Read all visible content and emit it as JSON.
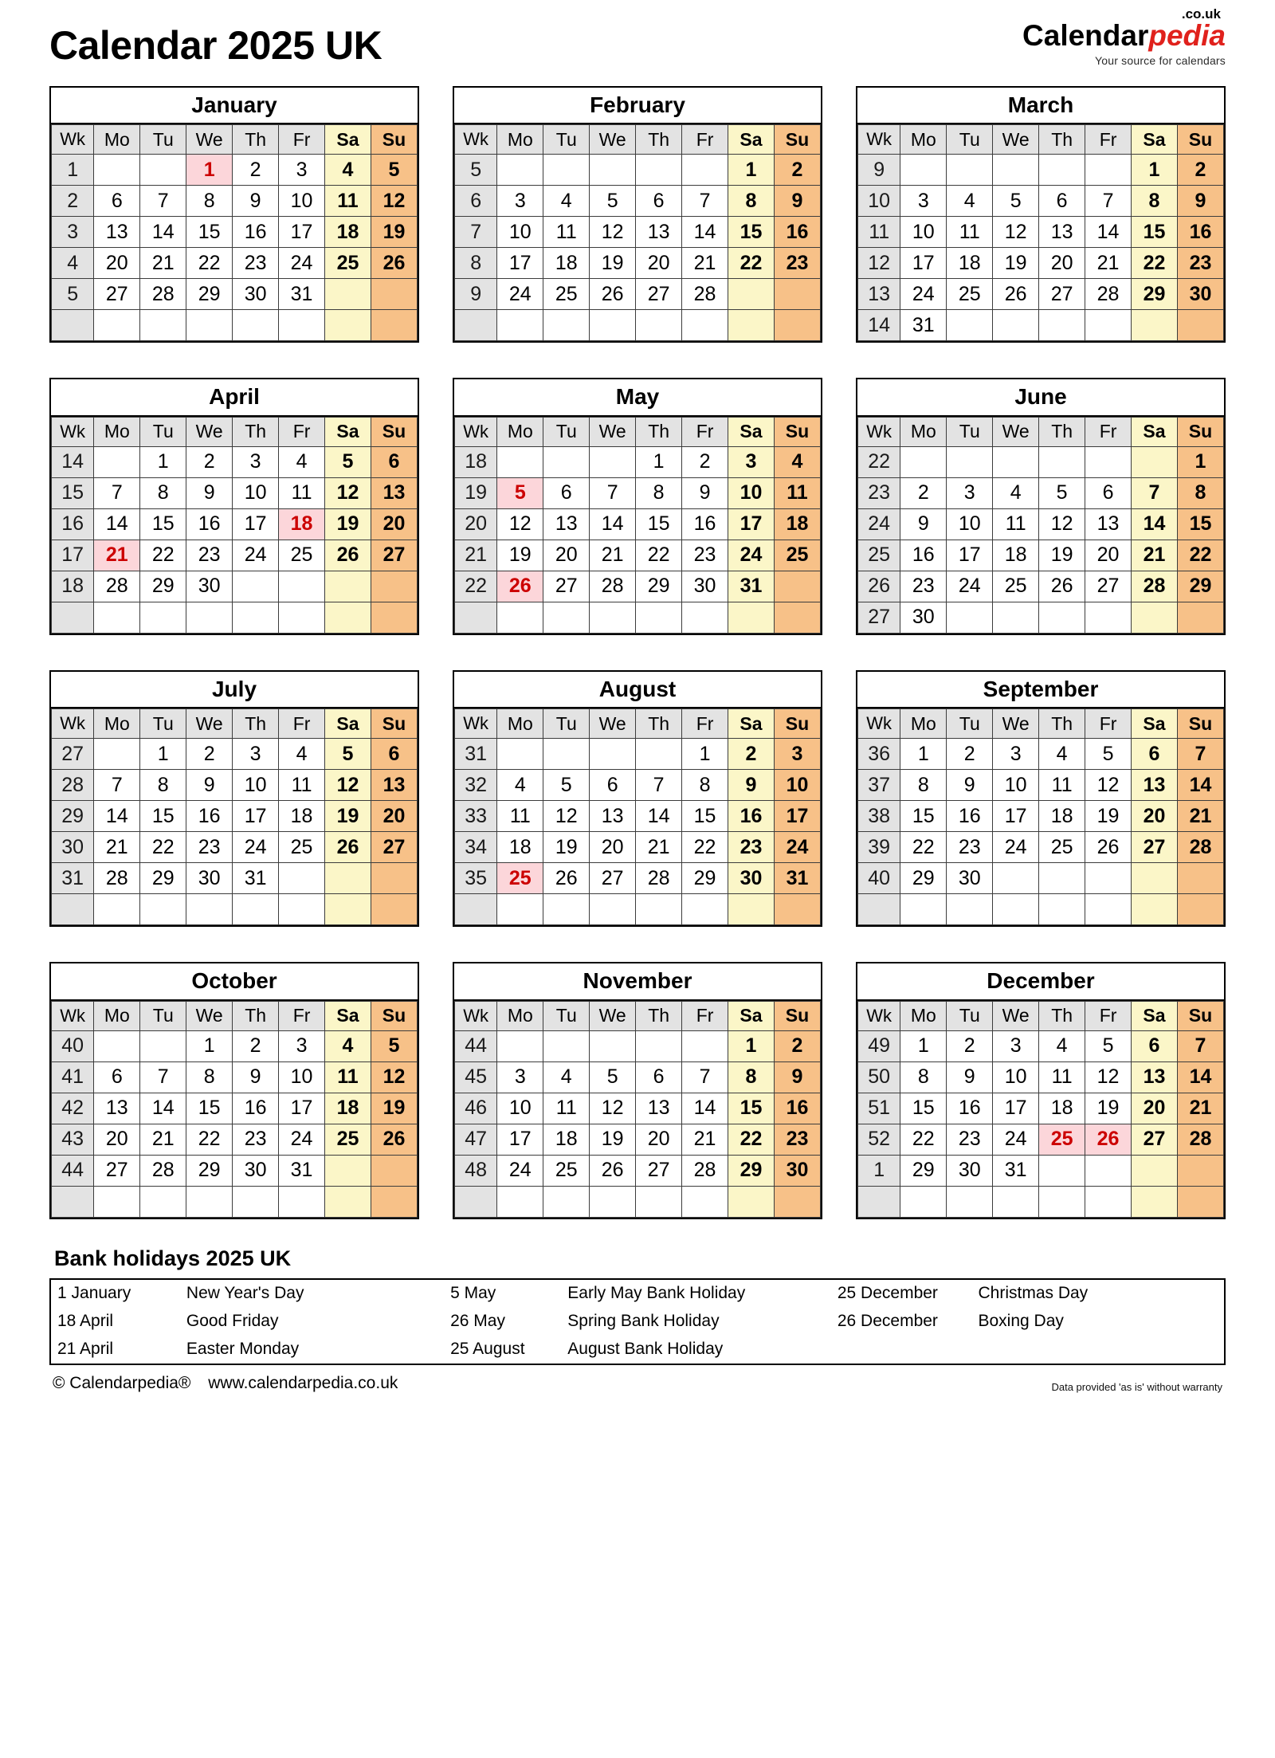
{
  "header": {
    "title": "Calendar 2025 UK",
    "brand": {
      "part_dark": "Calendar",
      "part_red": "pedia",
      "tld": ".co.uk",
      "tagline": "Your source for calendars"
    }
  },
  "weekday_headers": [
    "Wk",
    "Mo",
    "Tu",
    "We",
    "Th",
    "Fr",
    "Sa",
    "Su"
  ],
  "colors": {
    "saturday_bg": "#fbf6c8",
    "sunday_bg": "#f7c188",
    "week_bg": "#e3e3e3",
    "weekday_header_bg": "#e3e3e3",
    "holiday_bg": "#fcd6da",
    "holiday_text": "#cc0000",
    "brand_red": "#e0211c"
  },
  "months": [
    {
      "name": "January",
      "weeks": [
        {
          "wk": "1",
          "days": [
            "",
            "",
            "1",
            "2",
            "3",
            "4",
            "5"
          ],
          "holidays": [
            2
          ]
        },
        {
          "wk": "2",
          "days": [
            "6",
            "7",
            "8",
            "9",
            "10",
            "11",
            "12"
          ],
          "holidays": []
        },
        {
          "wk": "3",
          "days": [
            "13",
            "14",
            "15",
            "16",
            "17",
            "18",
            "19"
          ],
          "holidays": []
        },
        {
          "wk": "4",
          "days": [
            "20",
            "21",
            "22",
            "23",
            "24",
            "25",
            "26"
          ],
          "holidays": []
        },
        {
          "wk": "5",
          "days": [
            "27",
            "28",
            "29",
            "30",
            "31",
            "",
            ""
          ],
          "holidays": []
        },
        {
          "wk": "",
          "days": [
            "",
            "",
            "",
            "",
            "",
            "",
            ""
          ],
          "holidays": []
        }
      ]
    },
    {
      "name": "February",
      "weeks": [
        {
          "wk": "5",
          "days": [
            "",
            "",
            "",
            "",
            "",
            "1",
            "2"
          ],
          "holidays": []
        },
        {
          "wk": "6",
          "days": [
            "3",
            "4",
            "5",
            "6",
            "7",
            "8",
            "9"
          ],
          "holidays": []
        },
        {
          "wk": "7",
          "days": [
            "10",
            "11",
            "12",
            "13",
            "14",
            "15",
            "16"
          ],
          "holidays": []
        },
        {
          "wk": "8",
          "days": [
            "17",
            "18",
            "19",
            "20",
            "21",
            "22",
            "23"
          ],
          "holidays": []
        },
        {
          "wk": "9",
          "days": [
            "24",
            "25",
            "26",
            "27",
            "28",
            "",
            ""
          ],
          "holidays": []
        },
        {
          "wk": "",
          "days": [
            "",
            "",
            "",
            "",
            "",
            "",
            ""
          ],
          "holidays": []
        }
      ]
    },
    {
      "name": "March",
      "weeks": [
        {
          "wk": "9",
          "days": [
            "",
            "",
            "",
            "",
            "",
            "1",
            "2"
          ],
          "holidays": []
        },
        {
          "wk": "10",
          "days": [
            "3",
            "4",
            "5",
            "6",
            "7",
            "8",
            "9"
          ],
          "holidays": []
        },
        {
          "wk": "11",
          "days": [
            "10",
            "11",
            "12",
            "13",
            "14",
            "15",
            "16"
          ],
          "holidays": []
        },
        {
          "wk": "12",
          "days": [
            "17",
            "18",
            "19",
            "20",
            "21",
            "22",
            "23"
          ],
          "holidays": []
        },
        {
          "wk": "13",
          "days": [
            "24",
            "25",
            "26",
            "27",
            "28",
            "29",
            "30"
          ],
          "holidays": []
        },
        {
          "wk": "14",
          "days": [
            "31",
            "",
            "",
            "",
            "",
            "",
            ""
          ],
          "holidays": []
        }
      ]
    },
    {
      "name": "April",
      "weeks": [
        {
          "wk": "14",
          "days": [
            "",
            "1",
            "2",
            "3",
            "4",
            "5",
            "6"
          ],
          "holidays": []
        },
        {
          "wk": "15",
          "days": [
            "7",
            "8",
            "9",
            "10",
            "11",
            "12",
            "13"
          ],
          "holidays": []
        },
        {
          "wk": "16",
          "days": [
            "14",
            "15",
            "16",
            "17",
            "18",
            "19",
            "20"
          ],
          "holidays": [
            4
          ]
        },
        {
          "wk": "17",
          "days": [
            "21",
            "22",
            "23",
            "24",
            "25",
            "26",
            "27"
          ],
          "holidays": [
            0
          ]
        },
        {
          "wk": "18",
          "days": [
            "28",
            "29",
            "30",
            "",
            "",
            "",
            ""
          ],
          "holidays": []
        },
        {
          "wk": "",
          "days": [
            "",
            "",
            "",
            "",
            "",
            "",
            ""
          ],
          "holidays": []
        }
      ]
    },
    {
      "name": "May",
      "weeks": [
        {
          "wk": "18",
          "days": [
            "",
            "",
            "",
            "1",
            "2",
            "3",
            "4"
          ],
          "holidays": []
        },
        {
          "wk": "19",
          "days": [
            "5",
            "6",
            "7",
            "8",
            "9",
            "10",
            "11"
          ],
          "holidays": [
            0
          ]
        },
        {
          "wk": "20",
          "days": [
            "12",
            "13",
            "14",
            "15",
            "16",
            "17",
            "18"
          ],
          "holidays": []
        },
        {
          "wk": "21",
          "days": [
            "19",
            "20",
            "21",
            "22",
            "23",
            "24",
            "25"
          ],
          "holidays": []
        },
        {
          "wk": "22",
          "days": [
            "26",
            "27",
            "28",
            "29",
            "30",
            "31",
            ""
          ],
          "holidays": [
            0
          ]
        },
        {
          "wk": "",
          "days": [
            "",
            "",
            "",
            "",
            "",
            "",
            ""
          ],
          "holidays": []
        }
      ]
    },
    {
      "name": "June",
      "weeks": [
        {
          "wk": "22",
          "days": [
            "",
            "",
            "",
            "",
            "",
            "",
            "1"
          ],
          "holidays": []
        },
        {
          "wk": "23",
          "days": [
            "2",
            "3",
            "4",
            "5",
            "6",
            "7",
            "8"
          ],
          "holidays": []
        },
        {
          "wk": "24",
          "days": [
            "9",
            "10",
            "11",
            "12",
            "13",
            "14",
            "15"
          ],
          "holidays": []
        },
        {
          "wk": "25",
          "days": [
            "16",
            "17",
            "18",
            "19",
            "20",
            "21",
            "22"
          ],
          "holidays": []
        },
        {
          "wk": "26",
          "days": [
            "23",
            "24",
            "25",
            "26",
            "27",
            "28",
            "29"
          ],
          "holidays": []
        },
        {
          "wk": "27",
          "days": [
            "30",
            "",
            "",
            "",
            "",
            "",
            ""
          ],
          "holidays": []
        }
      ]
    },
    {
      "name": "July",
      "weeks": [
        {
          "wk": "27",
          "days": [
            "",
            "1",
            "2",
            "3",
            "4",
            "5",
            "6"
          ],
          "holidays": []
        },
        {
          "wk": "28",
          "days": [
            "7",
            "8",
            "9",
            "10",
            "11",
            "12",
            "13"
          ],
          "holidays": []
        },
        {
          "wk": "29",
          "days": [
            "14",
            "15",
            "16",
            "17",
            "18",
            "19",
            "20"
          ],
          "holidays": []
        },
        {
          "wk": "30",
          "days": [
            "21",
            "22",
            "23",
            "24",
            "25",
            "26",
            "27"
          ],
          "holidays": []
        },
        {
          "wk": "31",
          "days": [
            "28",
            "29",
            "30",
            "31",
            "",
            "",
            ""
          ],
          "holidays": []
        },
        {
          "wk": "",
          "days": [
            "",
            "",
            "",
            "",
            "",
            "",
            ""
          ],
          "holidays": []
        }
      ]
    },
    {
      "name": "August",
      "weeks": [
        {
          "wk": "31",
          "days": [
            "",
            "",
            "",
            "",
            "1",
            "2",
            "3"
          ],
          "holidays": []
        },
        {
          "wk": "32",
          "days": [
            "4",
            "5",
            "6",
            "7",
            "8",
            "9",
            "10"
          ],
          "holidays": []
        },
        {
          "wk": "33",
          "days": [
            "11",
            "12",
            "13",
            "14",
            "15",
            "16",
            "17"
          ],
          "holidays": []
        },
        {
          "wk": "34",
          "days": [
            "18",
            "19",
            "20",
            "21",
            "22",
            "23",
            "24"
          ],
          "holidays": []
        },
        {
          "wk": "35",
          "days": [
            "25",
            "26",
            "27",
            "28",
            "29",
            "30",
            "31"
          ],
          "holidays": [
            0
          ]
        },
        {
          "wk": "",
          "days": [
            "",
            "",
            "",
            "",
            "",
            "",
            ""
          ],
          "holidays": []
        }
      ]
    },
    {
      "name": "September",
      "weeks": [
        {
          "wk": "36",
          "days": [
            "1",
            "2",
            "3",
            "4",
            "5",
            "6",
            "7"
          ],
          "holidays": []
        },
        {
          "wk": "37",
          "days": [
            "8",
            "9",
            "10",
            "11",
            "12",
            "13",
            "14"
          ],
          "holidays": []
        },
        {
          "wk": "38",
          "days": [
            "15",
            "16",
            "17",
            "18",
            "19",
            "20",
            "21"
          ],
          "holidays": []
        },
        {
          "wk": "39",
          "days": [
            "22",
            "23",
            "24",
            "25",
            "26",
            "27",
            "28"
          ],
          "holidays": []
        },
        {
          "wk": "40",
          "days": [
            "29",
            "30",
            "",
            "",
            "",
            "",
            ""
          ],
          "holidays": []
        },
        {
          "wk": "",
          "days": [
            "",
            "",
            "",
            "",
            "",
            "",
            ""
          ],
          "holidays": []
        }
      ]
    },
    {
      "name": "October",
      "weeks": [
        {
          "wk": "40",
          "days": [
            "",
            "",
            "1",
            "2",
            "3",
            "4",
            "5"
          ],
          "holidays": []
        },
        {
          "wk": "41",
          "days": [
            "6",
            "7",
            "8",
            "9",
            "10",
            "11",
            "12"
          ],
          "holidays": []
        },
        {
          "wk": "42",
          "days": [
            "13",
            "14",
            "15",
            "16",
            "17",
            "18",
            "19"
          ],
          "holidays": []
        },
        {
          "wk": "43",
          "days": [
            "20",
            "21",
            "22",
            "23",
            "24",
            "25",
            "26"
          ],
          "holidays": []
        },
        {
          "wk": "44",
          "days": [
            "27",
            "28",
            "29",
            "30",
            "31",
            "",
            ""
          ],
          "holidays": []
        },
        {
          "wk": "",
          "days": [
            "",
            "",
            "",
            "",
            "",
            "",
            ""
          ],
          "holidays": []
        }
      ]
    },
    {
      "name": "November",
      "weeks": [
        {
          "wk": "44",
          "days": [
            "",
            "",
            "",
            "",
            "",
            "1",
            "2"
          ],
          "holidays": []
        },
        {
          "wk": "45",
          "days": [
            "3",
            "4",
            "5",
            "6",
            "7",
            "8",
            "9"
          ],
          "holidays": []
        },
        {
          "wk": "46",
          "days": [
            "10",
            "11",
            "12",
            "13",
            "14",
            "15",
            "16"
          ],
          "holidays": []
        },
        {
          "wk": "47",
          "days": [
            "17",
            "18",
            "19",
            "20",
            "21",
            "22",
            "23"
          ],
          "holidays": []
        },
        {
          "wk": "48",
          "days": [
            "24",
            "25",
            "26",
            "27",
            "28",
            "29",
            "30"
          ],
          "holidays": []
        },
        {
          "wk": "",
          "days": [
            "",
            "",
            "",
            "",
            "",
            "",
            ""
          ],
          "holidays": []
        }
      ]
    },
    {
      "name": "December",
      "weeks": [
        {
          "wk": "49",
          "days": [
            "1",
            "2",
            "3",
            "4",
            "5",
            "6",
            "7"
          ],
          "holidays": []
        },
        {
          "wk": "50",
          "days": [
            "8",
            "9",
            "10",
            "11",
            "12",
            "13",
            "14"
          ],
          "holidays": []
        },
        {
          "wk": "51",
          "days": [
            "15",
            "16",
            "17",
            "18",
            "19",
            "20",
            "21"
          ],
          "holidays": []
        },
        {
          "wk": "52",
          "days": [
            "22",
            "23",
            "24",
            "25",
            "26",
            "27",
            "28"
          ],
          "holidays": [
            3,
            4
          ]
        },
        {
          "wk": "1",
          "days": [
            "29",
            "30",
            "31",
            "",
            "",
            "",
            ""
          ],
          "holidays": []
        },
        {
          "wk": "",
          "days": [
            "",
            "",
            "",
            "",
            "",
            "",
            ""
          ],
          "holidays": []
        }
      ]
    }
  ],
  "bank_holidays": {
    "title": "Bank holidays 2025 UK",
    "rows": [
      [
        "1 January",
        "New Year's Day",
        "5 May",
        "Early May Bank Holiday",
        "25 December",
        "Christmas Day"
      ],
      [
        "18 April",
        "Good Friday",
        "26 May",
        "Spring Bank Holiday",
        "26 December",
        "Boxing Day"
      ],
      [
        "21 April",
        "Easter Monday",
        "25 August",
        "August Bank Holiday",
        "",
        ""
      ]
    ]
  },
  "footer": {
    "copyright": "© Calendarpedia®",
    "url": "www.calendarpedia.co.uk",
    "disclaimer": "Data provided 'as is' without warranty"
  }
}
